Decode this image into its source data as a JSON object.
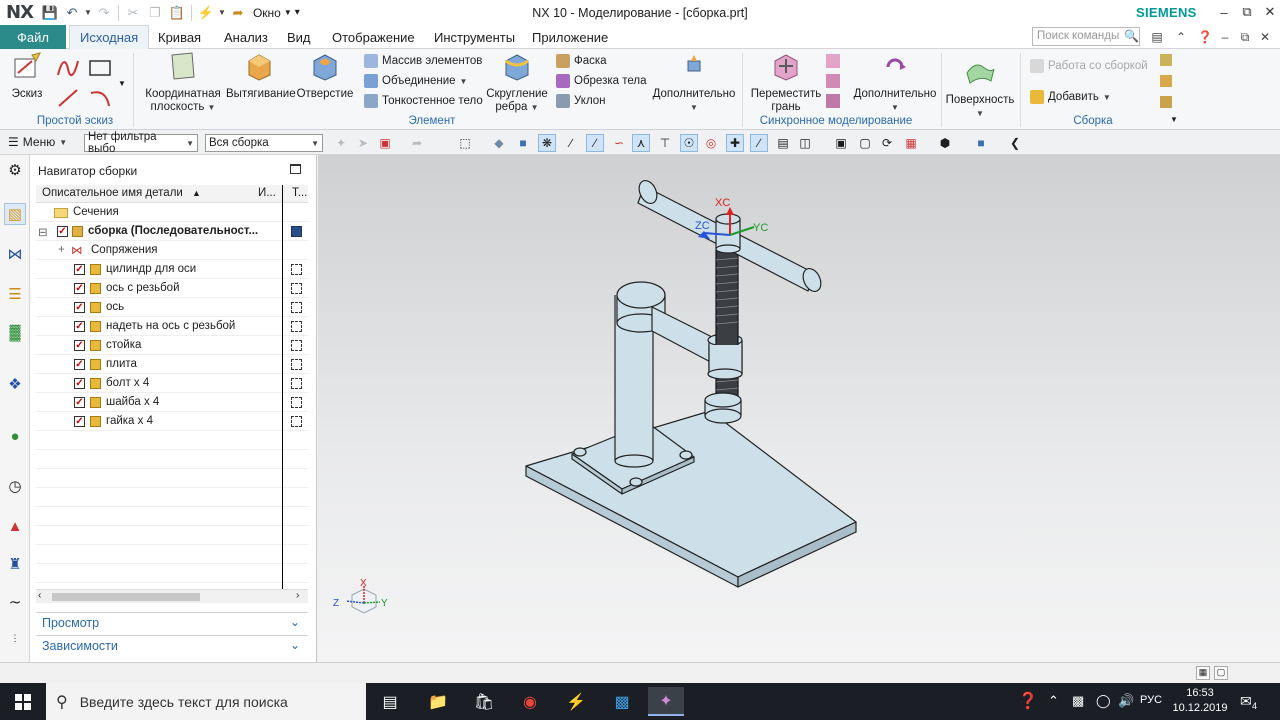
{
  "titlebar": {
    "logo": "NX",
    "window_menu": "Окно",
    "title": "NX 10 - Моделирование - [сборка.prt]",
    "brand": "SIEMENS",
    "brand_color": "#009999"
  },
  "tabs": {
    "file": "Файл",
    "items": [
      "Исходная",
      "Кривая",
      "Анализ",
      "Вид",
      "Отображение",
      "Инструменты",
      "Приложение"
    ],
    "search_placeholder": "Поиск команды"
  },
  "ribbon": {
    "sketch_button": "Эскиз",
    "sketch_group": "Простой эскиз",
    "datum_csys": [
      "Координатная",
      "плоскость"
    ],
    "extrude": "Вытягивание",
    "hole": "Отверстие",
    "pattern": "Массив элементов",
    "unite": "Объединение",
    "shell": "Тонкостенное тело",
    "edge_blend": [
      "Скругление",
      "ребра"
    ],
    "chamfer": "Фаска",
    "trim_body": "Обрезка тела",
    "draft": "Уклон",
    "more_feature": "Дополнительно",
    "feature_group": "Элемент",
    "move_face": [
      "Переместить",
      "грань"
    ],
    "more_sync": "Дополнительно",
    "sync_group": "Синхронное моделирование",
    "surface": "Поверхность",
    "work_with_assembly": "Работа со сборкой",
    "add": "Добавить",
    "assembly_group": "Сборка"
  },
  "toolbar": {
    "menu": "Меню",
    "filter": "Нет фильтра выбо",
    "scope": "Вся сборка"
  },
  "navigator": {
    "title": "Навигатор сборки",
    "col_name": "Описательное имя детали",
    "col_i": "И...",
    "col_t": "Т...",
    "sections": "Сечения",
    "root": "сборка (Последовательност...",
    "constraints": "Сопряжения",
    "parts": [
      "цилиндр для оси",
      "ось с резьбой",
      "ось",
      "надеть на ось с резьбой",
      "стойка",
      "плита",
      "болт x 4",
      "шайба x 4",
      "гайка x 4"
    ],
    "preview": "Просмотр",
    "dependencies": "Зависимости"
  },
  "viewport": {
    "axis_xc": "XC",
    "axis_yc": "YC",
    "axis_zc": "ZC",
    "triad_x": "X",
    "triad_y": "Y",
    "triad_z": "Z",
    "part_color": "#cde0ea",
    "background": "#e2e3e5"
  },
  "taskbar": {
    "search_placeholder": "Введите здесь текст для поиска",
    "lang": "РУС",
    "time": "16:53",
    "date": "10.12.2019",
    "notifications": "4"
  }
}
